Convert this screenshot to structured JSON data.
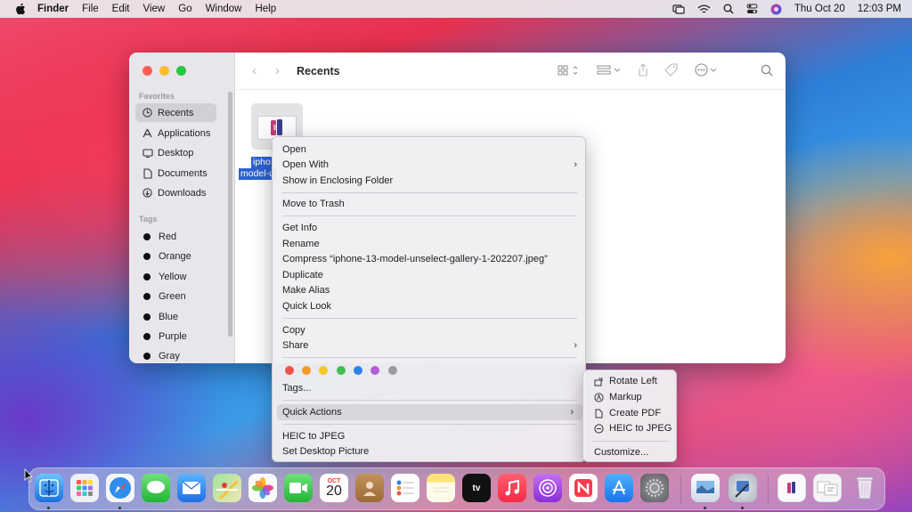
{
  "menubar": {
    "app_name": "Finder",
    "menus": [
      "File",
      "Edit",
      "View",
      "Go",
      "Window",
      "Help"
    ],
    "date": "Thu Oct 20",
    "time": "12:03 PM"
  },
  "window": {
    "title": "Recents",
    "sidebar": {
      "favorites_header": "Favorites",
      "favorites": [
        {
          "label": "Recents",
          "icon": "clock-icon"
        },
        {
          "label": "Applications",
          "icon": "applications-icon"
        },
        {
          "label": "Desktop",
          "icon": "desktop-icon"
        },
        {
          "label": "Documents",
          "icon": "document-icon"
        },
        {
          "label": "Downloads",
          "icon": "downloads-icon"
        }
      ],
      "tags_header": "Tags",
      "tags": [
        "Red",
        "Orange",
        "Yellow",
        "Green",
        "Blue",
        "Purple",
        "Gray"
      ]
    },
    "file": {
      "name_line1": "ipho",
      "name_line2": "model-u"
    }
  },
  "context_menu": {
    "open": "Open",
    "open_with": "Open With",
    "show_enclosing": "Show in Enclosing Folder",
    "move_to_trash": "Move to Trash",
    "get_info": "Get Info",
    "rename": "Rename",
    "compress": "Compress “iphone-13-model-unselect-gallery-1-202207.jpeg”",
    "duplicate": "Duplicate",
    "make_alias": "Make Alias",
    "quick_look": "Quick Look",
    "copy": "Copy",
    "share": "Share",
    "tag_colors": [
      "#f0514a",
      "#f39a2b",
      "#f5c92b",
      "#3fbf4e",
      "#2f82e9",
      "#b45cd8",
      "#9b9b9f"
    ],
    "tags": "Tags...",
    "quick_actions": "Quick Actions",
    "heic_to_jpeg": "HEIC to JPEG",
    "set_desktop": "Set Desktop Picture"
  },
  "submenu": {
    "rotate_left": "Rotate Left",
    "markup": "Markup",
    "create_pdf": "Create PDF",
    "heic_to_jpeg": "HEIC to JPEG",
    "customize": "Customize..."
  },
  "dock": {
    "calendar_month": "OCT",
    "calendar_day": "20"
  }
}
